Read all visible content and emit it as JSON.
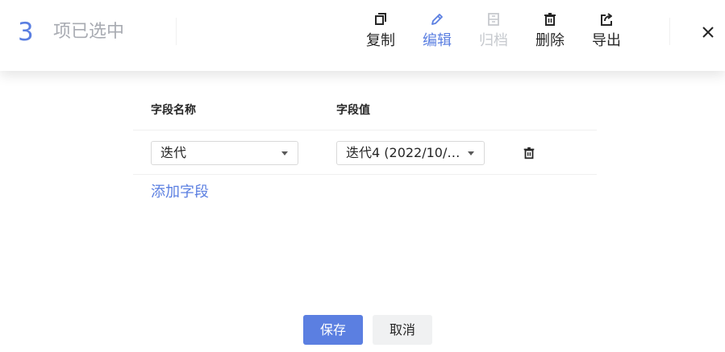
{
  "selection": {
    "count": "3",
    "label": "项已选中"
  },
  "toolbar": {
    "copy": "复制",
    "edit": "编辑",
    "archive": "归档",
    "delete": "删除",
    "export": "导出"
  },
  "table": {
    "headers": {
      "field_name": "字段名称",
      "field_value": "字段值"
    },
    "rows": [
      {
        "field_name": "迭代",
        "field_value": "迭代4 (2022/10/…"
      }
    ]
  },
  "add_field_label": "添加字段",
  "actions": {
    "save": "保存",
    "cancel": "取消"
  },
  "colors": {
    "accent": "#5b7fe1",
    "disabled": "#c6c9ce",
    "text": "#262626"
  },
  "icons": {
    "copy": "copy-icon",
    "edit": "pencil-icon",
    "archive": "archive-icon",
    "delete": "trash-icon",
    "export": "export-icon",
    "close": "close-icon"
  }
}
